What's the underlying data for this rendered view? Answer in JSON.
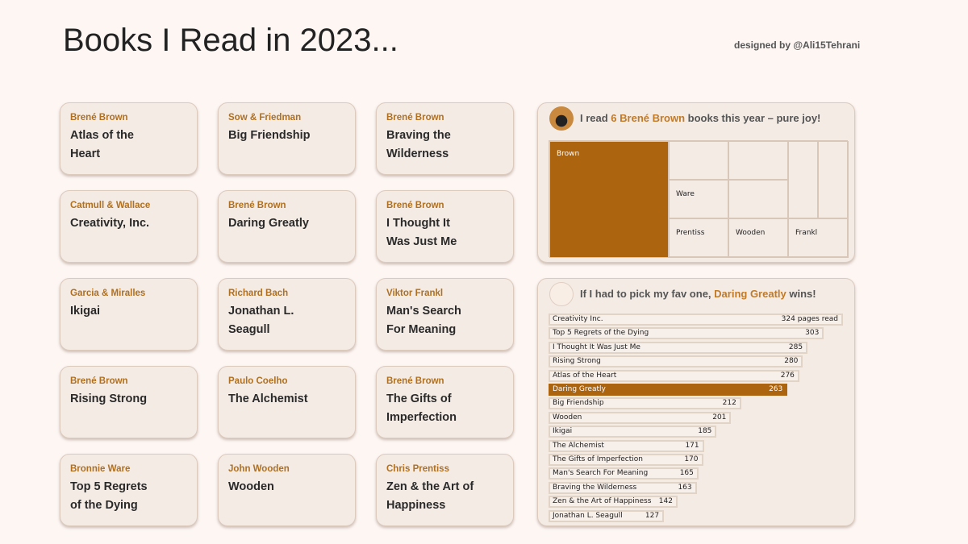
{
  "header": {
    "title": "Books I Read in 2023...",
    "credit": "designed by @Ali15Tehrani"
  },
  "cards": [
    {
      "author": "Brené Brown",
      "book": "Atlas of the Heart"
    },
    {
      "author": "Sow & Friedman",
      "book": "Big Friendship"
    },
    {
      "author": "Brené Brown",
      "book": "Braving the Wilderness"
    },
    {
      "author": "Catmull & Wallace",
      "book": "Creativity, Inc."
    },
    {
      "author": "Brené Brown",
      "book": "Daring Greatly"
    },
    {
      "author": "Brené Brown",
      "book": "I Thought It Was Just Me"
    },
    {
      "author": "Garcia & Miralles",
      "book": "Ikigai"
    },
    {
      "author": "Richard Bach",
      "book": "Jonathan L. Seagull"
    },
    {
      "author": "Viktor Frankl",
      "book": "Man's Search For Meaning"
    },
    {
      "author": "Brené Brown",
      "book": "Rising Strong"
    },
    {
      "author": "Paulo Coelho",
      "book": "The Alchemist"
    },
    {
      "author": "Brené Brown",
      "book": "The Gifts of Imperfection"
    },
    {
      "author": "Bronnie Ware",
      "book": "Top 5 Regrets of the Dying"
    },
    {
      "author": "John Wooden",
      "book": "Wooden"
    },
    {
      "author": "Chris Prentiss",
      "book": "Zen & the Art of Happiness"
    }
  ],
  "treemap_panel": {
    "pre": "I read ",
    "hl": "6 Brené Brown",
    "post": " books this year – pure joy!"
  },
  "bars_panel": {
    "pre": "If I had to pick my fav one, ",
    "hl": "Daring Greatly",
    "post": " wins!"
  },
  "chart_data": [
    {
      "type": "treemap",
      "cells": [
        {
          "label": "Brown",
          "value": 6,
          "highlight": true
        },
        {
          "label": "",
          "value": 1
        },
        {
          "label": "Ware",
          "value": 1
        },
        {
          "label": "",
          "value": 1
        },
        {
          "label": "",
          "value": 1
        },
        {
          "label": "",
          "value": 1
        },
        {
          "label": "",
          "value": 1
        },
        {
          "label": "Prentiss",
          "value": 1
        },
        {
          "label": "Wooden",
          "value": 1
        },
        {
          "label": "Frankl",
          "value": 1
        }
      ]
    },
    {
      "type": "bar",
      "unit_label": "pages read",
      "highlight": "Daring Greatly",
      "accent": "#ad640e",
      "categories": [
        "Creativity Inc.",
        "Top 5 Regrets of the Dying",
        "I Thought It Was Just Me",
        "Rising Strong",
        "Atlas of the Heart",
        "Daring Greatly",
        "Big Friendship",
        "Wooden",
        "Ikigai",
        "The Alchemist",
        "The Gifts of Imperfection",
        "Man's Search For Meaning",
        "Braving the Wilderness",
        "Zen & the Art of Happiness",
        "Jonathan L. Seagull"
      ],
      "values": [
        324,
        303,
        285,
        280,
        276,
        263,
        212,
        201,
        185,
        171,
        170,
        165,
        163,
        142,
        127
      ]
    }
  ]
}
